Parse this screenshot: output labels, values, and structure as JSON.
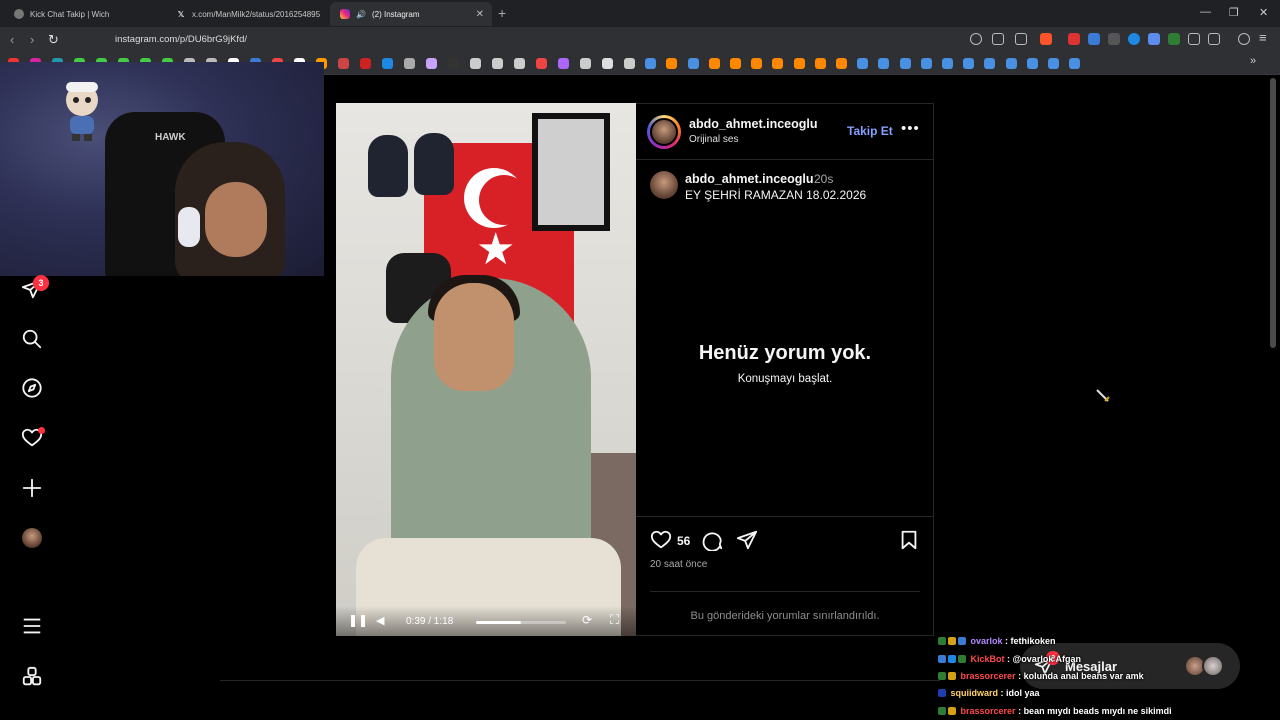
{
  "browser": {
    "tabs": [
      {
        "title": "Kick Chat Takip | Wich",
        "active": false
      },
      {
        "title": "x.com/ManMilk2/status/2016254895",
        "active": false
      },
      {
        "title": "(2) Instagram",
        "active": true
      }
    ],
    "url": "instagram.com/p/DU6brG9jKfd/",
    "new_tab": "+",
    "window_controls": {
      "minimize": "—",
      "restore": "❐",
      "close": "✕"
    }
  },
  "webcam": {
    "chair_logo": "HAWK"
  },
  "sidebar": {
    "notifications_badge": "3",
    "items": [
      "messages-icon",
      "search-icon",
      "explore-icon",
      "heart-icon",
      "create-icon",
      "profile-avatar",
      "menu-icon",
      "more-apps-icon"
    ]
  },
  "post": {
    "author": "abdo_ahmet.inceoglu",
    "audio": "Orijinal ses",
    "follow_label": "Takip Et",
    "more_label": "•••",
    "caption_author": "abdo_ahmet.inceoglu",
    "caption_time": "20s",
    "caption": "EY ŞEHRİ RAMAZAN 18.02.2026",
    "empty_title": "Henüz yorum yok.",
    "empty_sub": "Konuşmayı başlat.",
    "likes": "56",
    "posted_ago": "20 saat önce",
    "comments_limited": "Bu gönderideki yorumlar sınırlandırıldı.",
    "video": {
      "time": "0:39 / 1:18",
      "progress": 0.5
    }
  },
  "messages": {
    "label": "Mesajlar",
    "badge": "2"
  },
  "chat": [
    {
      "user": "ovarlok",
      "text": "fethikoken",
      "color": "#b488ff"
    },
    {
      "user": "KickBot",
      "text": "@ovarlok Afgan",
      "color": "#ff4a4a"
    },
    {
      "user": "brassorcerer",
      "text": "kolunda anal beans var amk",
      "color": "#ff4a4a"
    },
    {
      "user": "squiidward",
      "text": "idol yaa",
      "color": "#ffd36b"
    },
    {
      "user": "brassorcerer",
      "text": "bean mıydı beads mıydı ne sikimdi",
      "color": "#ff4a4a"
    }
  ]
}
